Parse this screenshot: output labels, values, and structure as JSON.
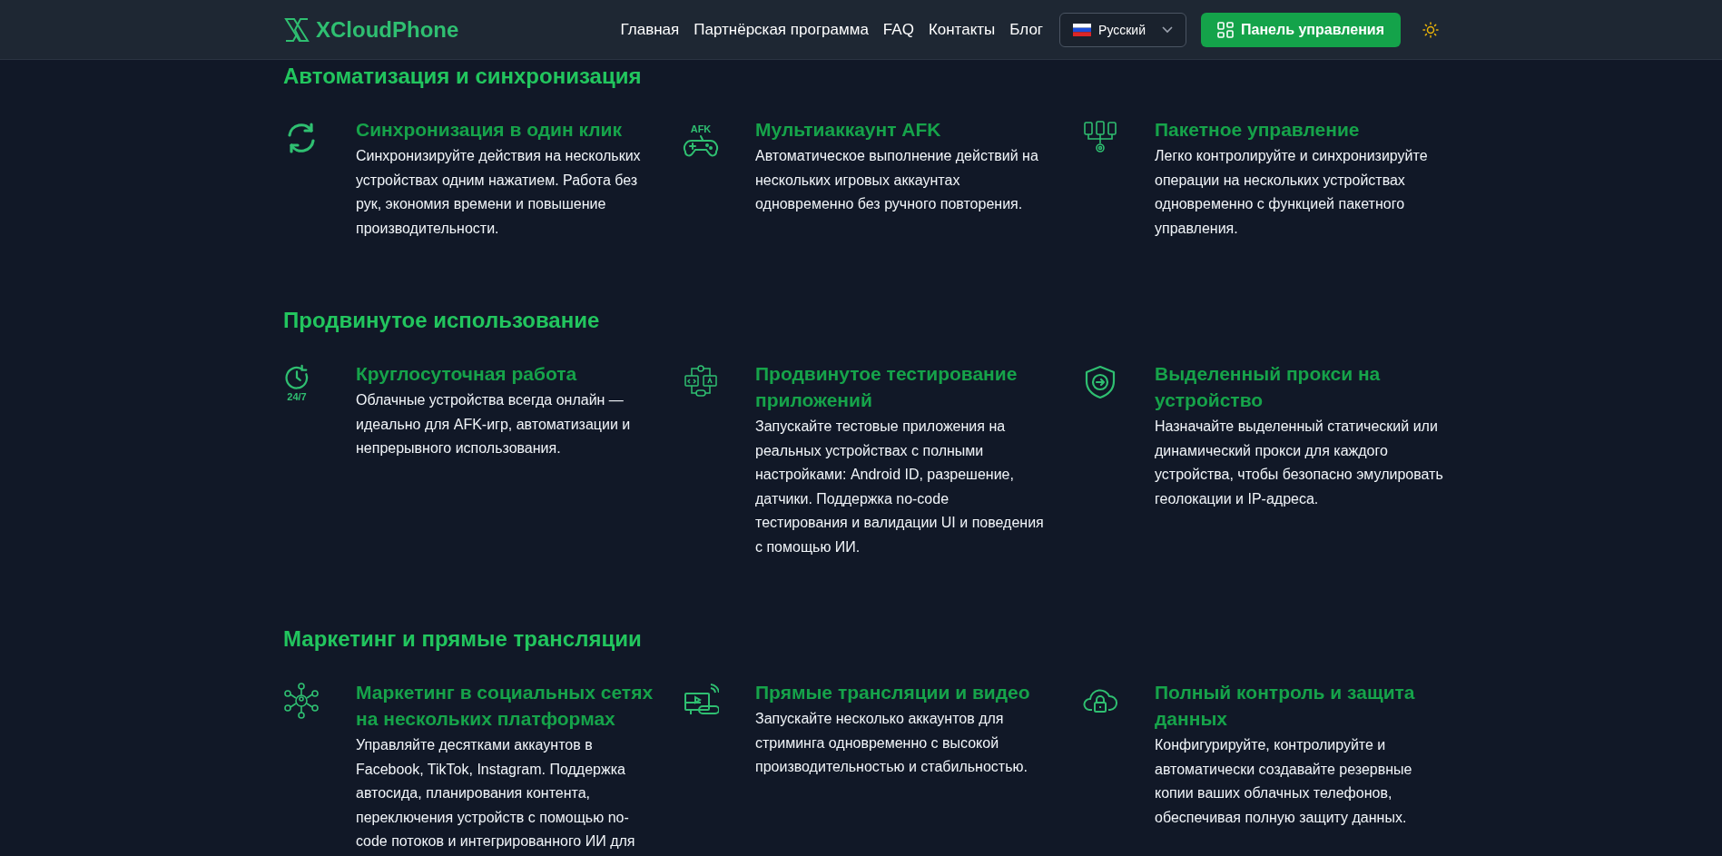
{
  "header": {
    "logo": "XCloudPhone",
    "nav": [
      "Главная",
      "Партнёрская программа",
      "FAQ",
      "Контакты",
      "Блог"
    ],
    "language": "Русский",
    "dashboard_button": "Панель управления"
  },
  "sections": [
    {
      "title": "Автоматизация и синхронизация",
      "features": [
        {
          "kind": "sync",
          "title": "Синхронизация в один клик",
          "text": "Синхронизируйте действия на нескольких устройствах одним нажатием. Работа без рук, экономия времени и повышение производительности."
        },
        {
          "kind": "gamepad",
          "icon_label": "AFK",
          "title": "Мультиаккаунт AFK",
          "text": "Автоматическое выполнение действий на нескольких игровых аккаунтах одновременно без ручного повторения."
        },
        {
          "kind": "devices",
          "title": "Пакетное управление",
          "text": "Легко контролируйте и синхронизируйте операции на нескольких устройствах одновременно с функцией пакетного управления."
        }
      ]
    },
    {
      "title": "Продвинутое использование",
      "features": [
        {
          "kind": "clock",
          "icon_label": "24/7",
          "title": "Круглосуточная работа",
          "text": "Облачные устройства всегда онлайн — идеально для AFK-игр, автоматизации и непрерывного использования."
        },
        {
          "kind": "testing",
          "title": "Продвинутое тестирование приложений",
          "text": "Запускайте тестовые приложения на реальных устройствах с полными настройками: Android ID, разрешение, датчики. Поддержка no-code тестирования и валидации UI и поведения с помощью ИИ."
        },
        {
          "kind": "shield",
          "title": "Выделенный прокси на устройство",
          "text": "Назначайте выделенный статический или динамический прокси для каждого устройства, чтобы безопасно эмулировать геолокации и IP-адреса."
        }
      ]
    },
    {
      "title": "Маркетинг и прямые трансляции",
      "features": [
        {
          "kind": "network",
          "title": "Маркетинг в социальных сетях на нескольких платформах",
          "text": "Управляйте десятками аккаунтов в Facebook, TikTok, Instagram. Поддержка автосида, планирования контента, переключения устройств с помощью no-code потоков и интегрированного ИИ для"
        },
        {
          "kind": "stream",
          "title": "Прямые трансляции и видео",
          "text": "Запускайте несколько аккаунтов для стриминга одновременно с высокой производительностью и стабильностью."
        },
        {
          "kind": "cloud-lock",
          "title": "Полный контроль и защита данных",
          "text": "Конфигурируйте, контролируйте и автоматически создавайте резервные копии ваших облачных телефонов, обеспечивая полную защиту данных."
        }
      ]
    }
  ]
}
